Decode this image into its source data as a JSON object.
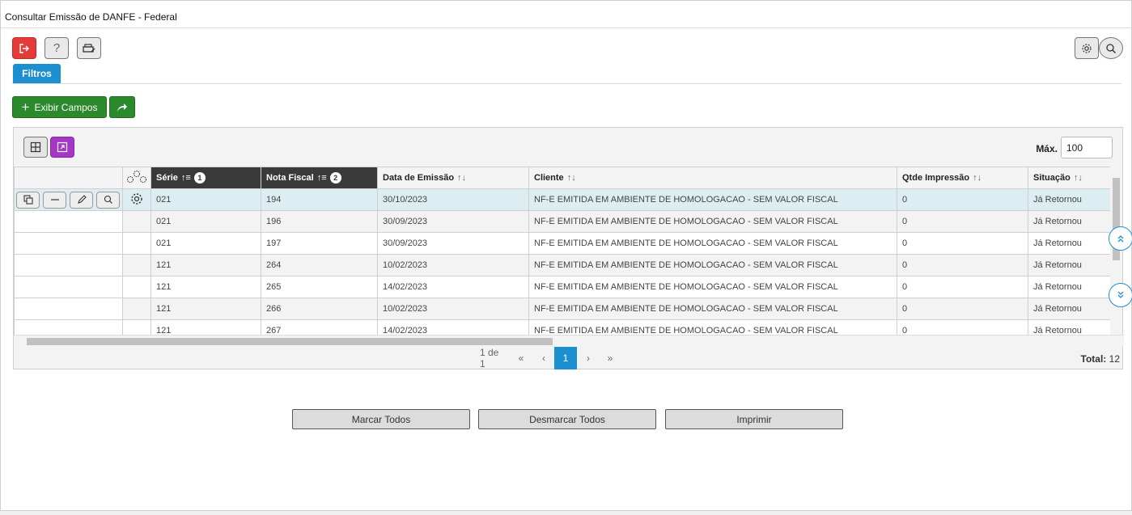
{
  "window": {
    "title": "Consultar Emissão de DANFE - Federal"
  },
  "toolbar": {
    "exit_icon": "exit-icon",
    "help_label": "?",
    "print_icon": "printer-icon",
    "settings_icon": "gear-icon",
    "search_icon": "search-icon"
  },
  "tabs": {
    "filtros": "Filtros"
  },
  "actions": {
    "exibir_campos": "Exibir Campos",
    "add_icon": "plus-icon",
    "share_icon": "share-icon"
  },
  "grid": {
    "max_label": "Máx.",
    "max_value": "100",
    "columns": [
      {
        "label": "Série",
        "sort_order": "1"
      },
      {
        "label": "Nota Fiscal",
        "sort_order": "2"
      },
      {
        "label": "Data de Emissão"
      },
      {
        "label": "Cliente"
      },
      {
        "label": "Qtde Impressão"
      },
      {
        "label": "Situação"
      }
    ],
    "rows": [
      {
        "serie": "021",
        "nota": "194",
        "data": "30/10/2023",
        "cliente": "NF-E EMITIDA EM AMBIENTE DE HOMOLOGACAO - SEM VALOR FISCAL",
        "qtde": "0",
        "situacao": "Já Retornou"
      },
      {
        "serie": "021",
        "nota": "196",
        "data": "30/09/2023",
        "cliente": "NF-E EMITIDA EM AMBIENTE DE HOMOLOGACAO - SEM VALOR FISCAL",
        "qtde": "0",
        "situacao": "Já Retornou"
      },
      {
        "serie": "021",
        "nota": "197",
        "data": "30/09/2023",
        "cliente": "NF-E EMITIDA EM AMBIENTE DE HOMOLOGACAO - SEM VALOR FISCAL",
        "qtde": "0",
        "situacao": "Já Retornou"
      },
      {
        "serie": "121",
        "nota": "264",
        "data": "10/02/2023",
        "cliente": "NF-E EMITIDA EM AMBIENTE DE HOMOLOGACAO - SEM VALOR FISCAL",
        "qtde": "0",
        "situacao": "Já Retornou"
      },
      {
        "serie": "121",
        "nota": "265",
        "data": "14/02/2023",
        "cliente": "NF-E EMITIDA EM AMBIENTE DE HOMOLOGACAO - SEM VALOR FISCAL",
        "qtde": "0",
        "situacao": "Já Retornou"
      },
      {
        "serie": "121",
        "nota": "266",
        "data": "10/02/2023",
        "cliente": "NF-E EMITIDA EM AMBIENTE DE HOMOLOGACAO - SEM VALOR FISCAL",
        "qtde": "0",
        "situacao": "Já Retornou"
      },
      {
        "serie": "121",
        "nota": "267",
        "data": "14/02/2023",
        "cliente": "NF-E EMITIDA EM AMBIENTE DE HOMOLOGACAO - SEM VALOR FISCAL",
        "qtde": "0",
        "situacao": "Já Retornou"
      }
    ]
  },
  "pagination": {
    "page_info": "1 de 1",
    "first": "«",
    "prev": "‹",
    "current": "1",
    "next": "›",
    "last": "»",
    "total_label": "Total:",
    "total_value": "12"
  },
  "footer": {
    "marcar_todos": "Marcar Todos",
    "desmarcar_todos": "Desmarcar Todos",
    "imprimir": "Imprimir"
  },
  "colors": {
    "accent": "#1b8fd0",
    "danger": "#e53a3a",
    "success": "#2b8a2b",
    "purple": "#a636c6",
    "selected_row": "#ddeef3"
  }
}
